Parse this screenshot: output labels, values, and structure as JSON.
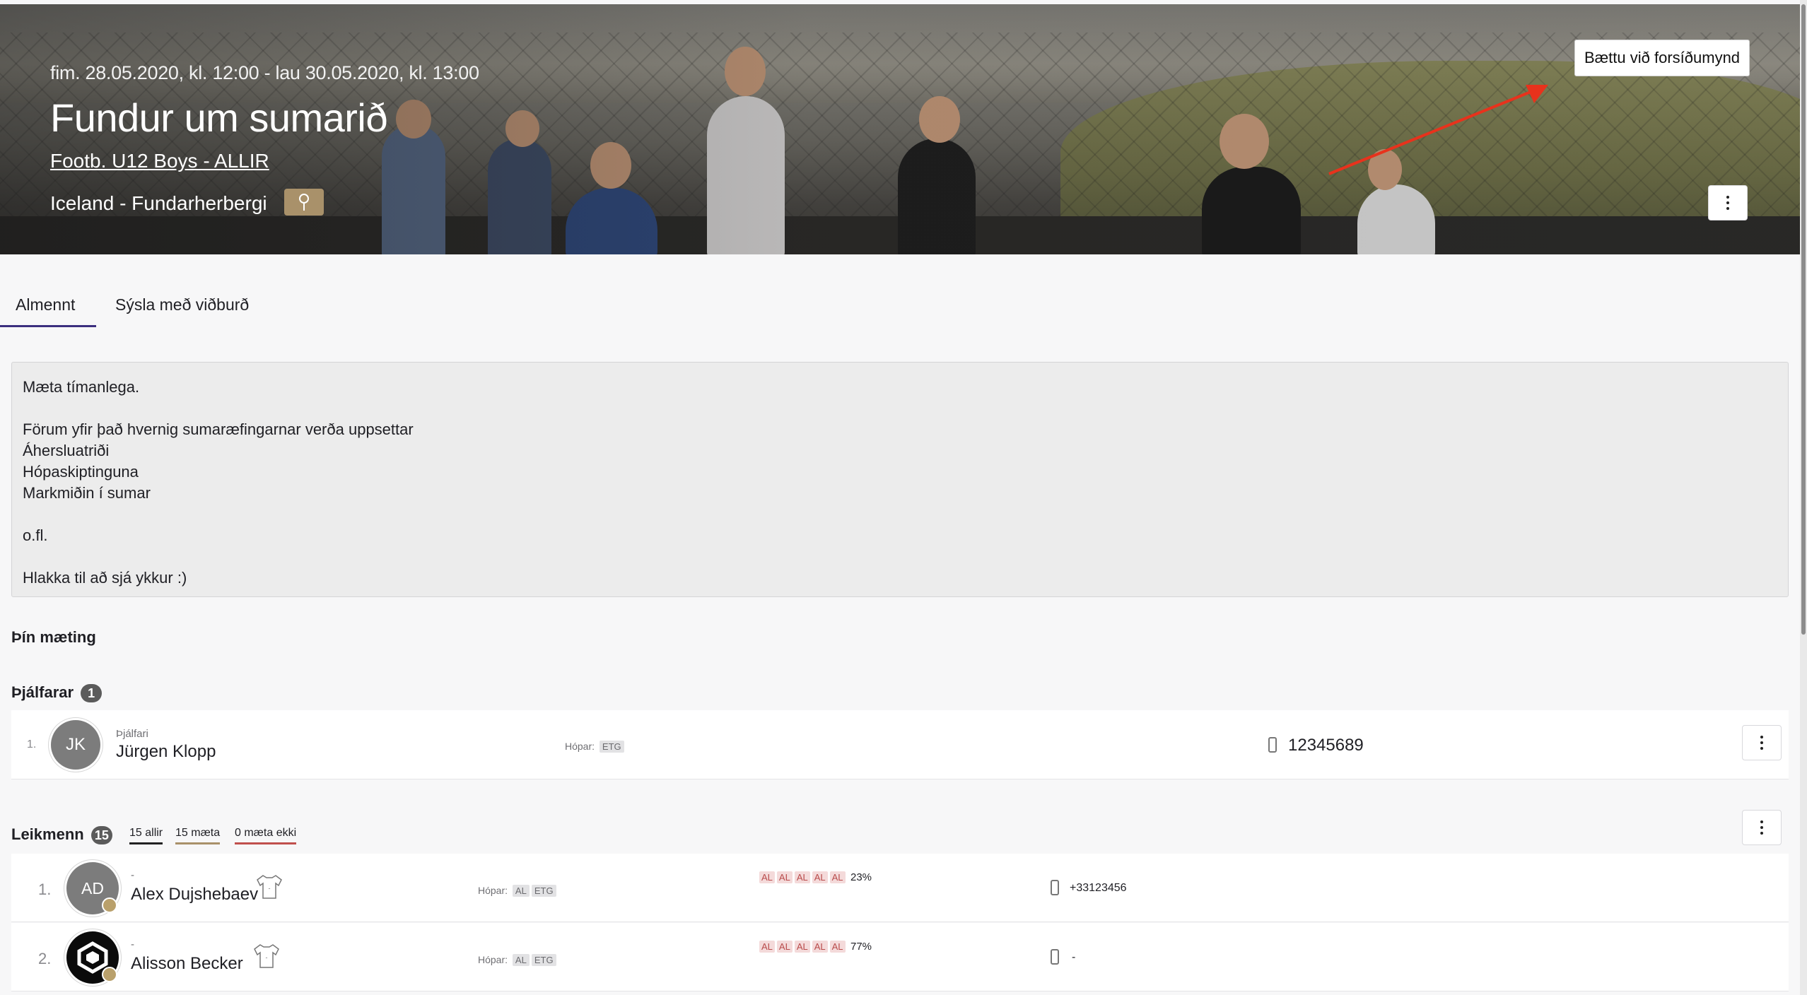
{
  "event": {
    "datetime": "fim. 28.05.2020, kl. 12:00 - lau 30.05.2020, kl. 13:00",
    "title": "Fundur um sumarið",
    "team": "Footb. U12 Boys - ALLIR",
    "location": "Iceland - Fundarherbergi",
    "add_cover_label": "Bættu við forsíðumynd"
  },
  "tabs": [
    {
      "label": "Almennt",
      "active": true
    },
    {
      "label": "Sýsla með viðburð",
      "active": false
    }
  ],
  "description": [
    "Mæta tímanlega.",
    "",
    "Förum yfir það hvernig sumaræfingarnar verða uppsettar",
    "Áherslua­triði",
    "Hópaskiptinguna",
    "Markmiðin í sumar",
    "",
    "o.fl.",
    "",
    "Hlakka til að sjá ykkur :)"
  ],
  "attendance_title": "Þín mæting",
  "coaches": {
    "title": "Þjálfarar",
    "count": "1",
    "items": [
      {
        "index": "1.",
        "initials": "JK",
        "role": "Þjálfari",
        "name": "Jürgen Klopp",
        "groups_label": "Hópar:",
        "groups": [
          "ETG"
        ],
        "phone": "12345689"
      }
    ]
  },
  "players": {
    "title": "Leikmenn",
    "count": "15",
    "filters": [
      {
        "label": "15 allir",
        "color": "#222222"
      },
      {
        "label": "15 mæta",
        "color": "#a9916a"
      },
      {
        "label": "0 mæta ekki",
        "color": "#c0504d"
      }
    ],
    "items": [
      {
        "index": "1.",
        "initials": "AD",
        "role": "-",
        "name": "Alex Dujshebaev",
        "groups_label": "Hópar:",
        "groups": [
          "AL",
          "ETG"
        ],
        "attendance": [
          "AL",
          "AL",
          "AL",
          "AL",
          "AL"
        ],
        "percent": "23%",
        "phone": "+33123456"
      },
      {
        "index": "2.",
        "initials": "",
        "role": "-",
        "name": "Alisson Becker",
        "groups_label": "Hópar:",
        "groups": [
          "AL",
          "ETG"
        ],
        "attendance": [
          "AL",
          "AL",
          "AL",
          "AL",
          "AL"
        ],
        "percent": "77%",
        "phone": "-"
      }
    ]
  },
  "colors": {
    "accent": "#3b2e7e",
    "pin": "#a9916a",
    "arrow": "#e8321c"
  }
}
